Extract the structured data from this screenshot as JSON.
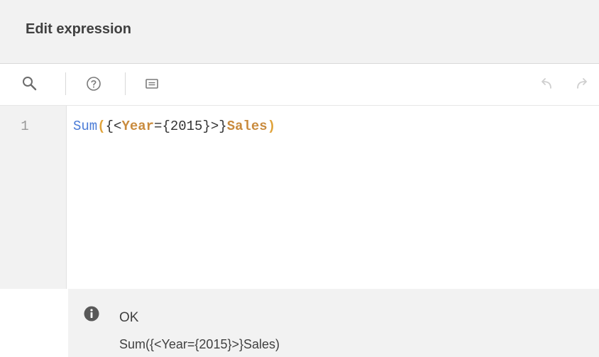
{
  "dialog": {
    "title": "Edit expression"
  },
  "toolbar": {
    "buttons": [
      {
        "icon": "search-icon"
      },
      {
        "icon": "help-icon"
      },
      {
        "icon": "comment-icon"
      },
      {
        "icon": "undo-icon"
      },
      {
        "icon": "redo-icon"
      }
    ]
  },
  "editor": {
    "line_number": "1",
    "tokens": {
      "fn": "Sum",
      "open_paren": "(",
      "set_open": "{<",
      "field": "Year",
      "eq_value": "={2015}",
      "set_close": ">}",
      "measure": "Sales",
      "close_paren": ")"
    }
  },
  "status": {
    "icon": "info-icon",
    "label": "OK",
    "expression": "Sum({<Year={2015}>}Sales)"
  },
  "colors": {
    "function": "#4a7bd6",
    "field": "#c98b3e",
    "paren": "#e0a33a",
    "header_bg": "#f2f2f2"
  }
}
